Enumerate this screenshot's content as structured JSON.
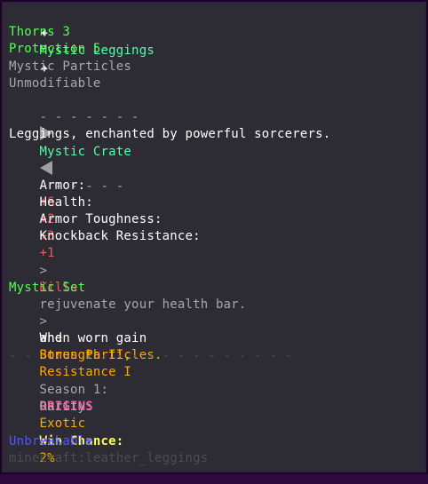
{
  "title": {
    "star": "✦",
    "text": "Mystic Leggings"
  },
  "enchants": [
    "Thorns 3",
    "Protection 5"
  ],
  "particles_label": "Mystic Particles",
  "unmodifiable_label": "Unmodifiable",
  "crate": {
    "dashes": "- - - - - - -",
    "name": "Mystic Crate",
    "dashes_right": "- - - - - -"
  },
  "description": "Leggings, enchanted by powerful sorcerers.",
  "stats": [
    {
      "label": "Armor:",
      "value": "+6"
    },
    {
      "label": "Health:",
      "value": "+2"
    },
    {
      "label": "Armor Toughness:",
      "value": "+3"
    },
    {
      "label": "Knockback Resistance:",
      "value": "+1"
    }
  ],
  "ability": {
    "arrow": ">",
    "highlight": "Kills",
    "rest": "rejuvenate your health bar."
  },
  "set": {
    "title": "Mystic Set",
    "arrow": ">",
    "prefix": "When worn gain",
    "bonus1": "Strength II,",
    "bonus2": "Resistance I",
    "and": "and",
    "bonus3": "Bonus Particles."
  },
  "divider": "- - - - - - - - - - - - - - - - - - -",
  "season": {
    "label": "Season 1:",
    "value": "ORIGINS"
  },
  "rarity": {
    "label": "Rarity:",
    "value": "Exotic"
  },
  "win": {
    "label": "Win Chance:",
    "value": "2%"
  },
  "unbreakable": "Unbreakable",
  "item_id": "minecraft:leather_leggings",
  "colors": {
    "background": "#2d2b34",
    "border": "#19071f",
    "green": "#55ff55",
    "aqua": "#55ffaa",
    "red": "#ff5555",
    "gold": "#ffaa00",
    "yellow": "#ffff55",
    "pink": "#ff55aa",
    "blue": "#5555ff"
  },
  "icons": {
    "left_arrow": "triangle-right-icon",
    "right_arrow": "triangle-left-icon",
    "star": "sparkle-icon"
  }
}
